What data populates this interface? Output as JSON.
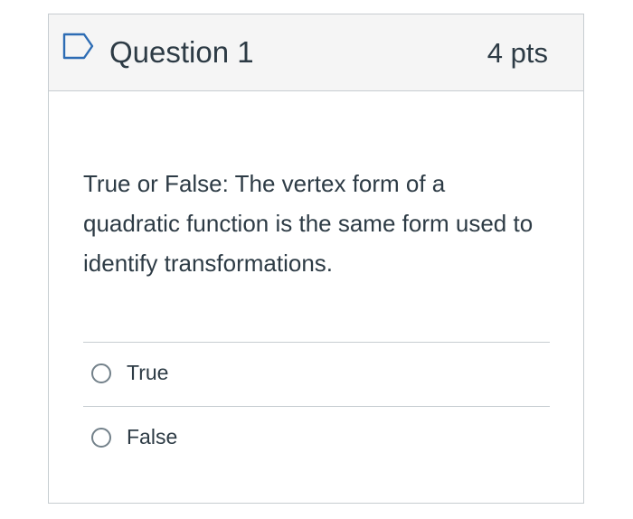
{
  "question": {
    "title": "Question 1",
    "points": "4 pts",
    "flag_icon": "flag-outline-icon",
    "text": "True or False: The vertex form of a quadratic function is the same form used to identify transformations."
  },
  "answers": [
    {
      "label": "True",
      "selected": false
    },
    {
      "label": "False",
      "selected": false
    }
  ],
  "colors": {
    "header_bg": "#f5f5f5",
    "border": "#c7cdd1",
    "text": "#2d3b45",
    "flag": "#2d6cb4"
  }
}
